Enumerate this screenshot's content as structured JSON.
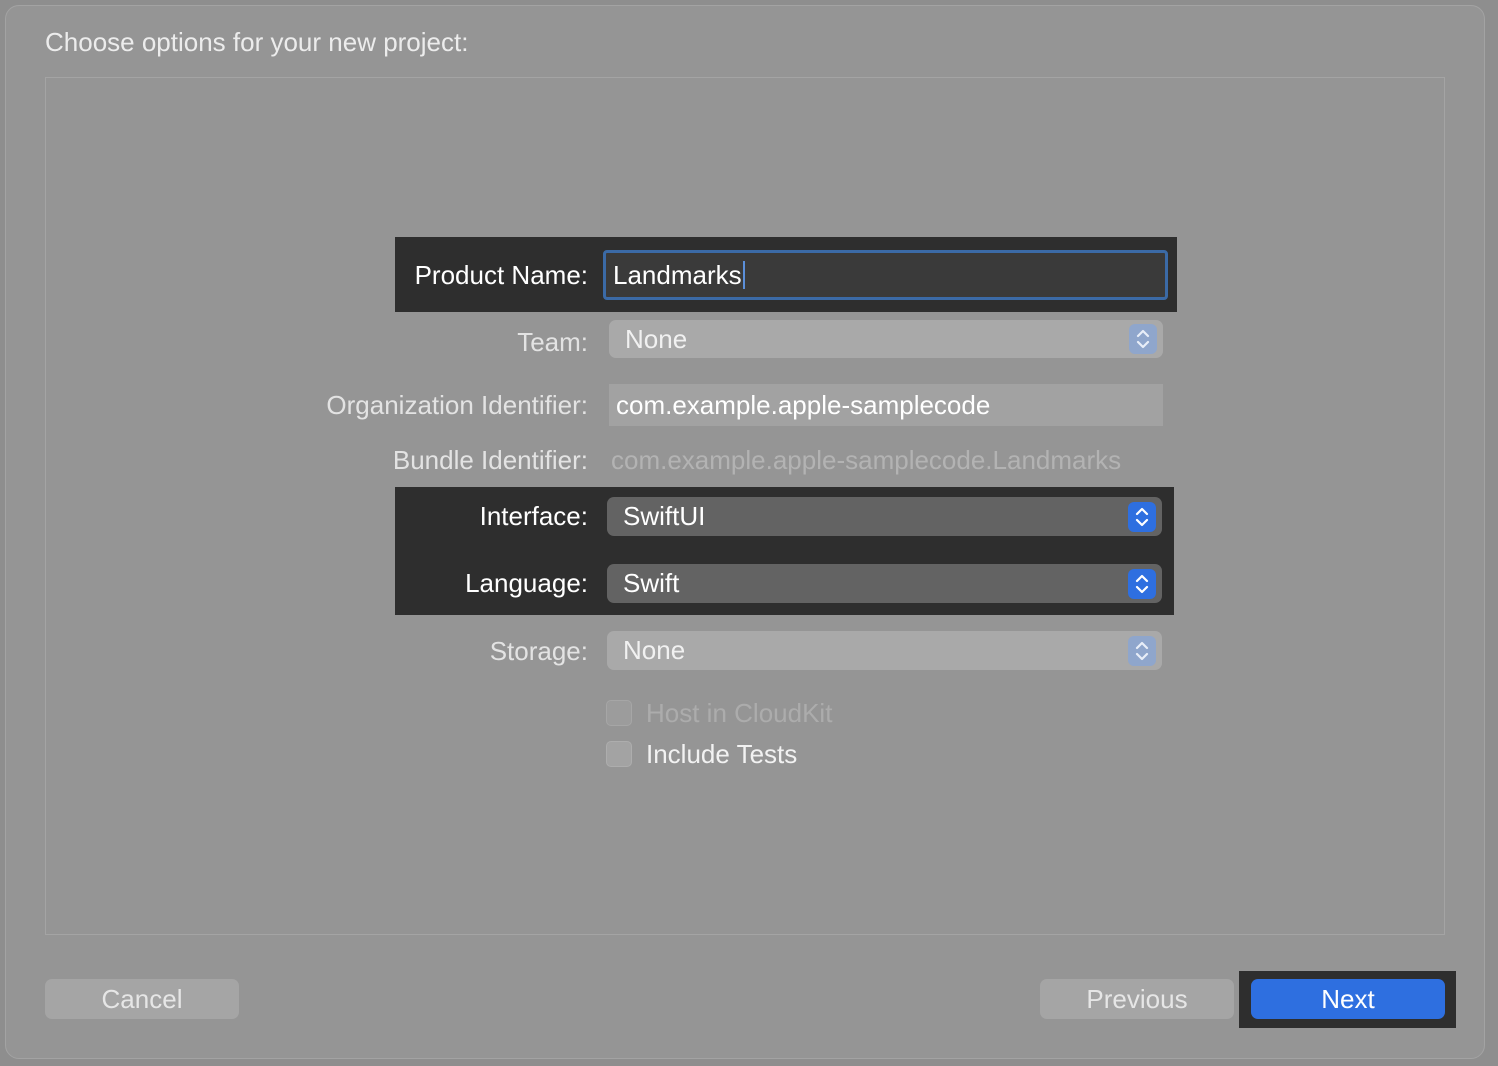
{
  "dialog": {
    "title": "Choose options for your new project:"
  },
  "form": {
    "product_name": {
      "label": "Product Name:",
      "value": "Landmarks"
    },
    "team": {
      "label": "Team:",
      "value": "None"
    },
    "organization_identifier": {
      "label": "Organization Identifier:",
      "value": "com.example.apple-samplecode"
    },
    "bundle_identifier": {
      "label": "Bundle Identifier:",
      "value": "com.example.apple-samplecode.Landmarks"
    },
    "interface": {
      "label": "Interface:",
      "value": "SwiftUI"
    },
    "language": {
      "label": "Language:",
      "value": "Swift"
    },
    "storage": {
      "label": "Storage:",
      "value": "None"
    },
    "host_in_cloudkit": {
      "label": "Host in CloudKit",
      "checked": false,
      "enabled": false
    },
    "include_tests": {
      "label": "Include Tests",
      "checked": false,
      "enabled": true
    }
  },
  "footer": {
    "cancel_label": "Cancel",
    "previous_label": "Previous",
    "next_label": "Next"
  },
  "colors": {
    "accent": "#2e6fe0",
    "highlight": "#2e2e2e",
    "focus_ring": "#3b6aa6"
  },
  "icons": {
    "popup_stepper": "chevron-up-down-icon"
  }
}
